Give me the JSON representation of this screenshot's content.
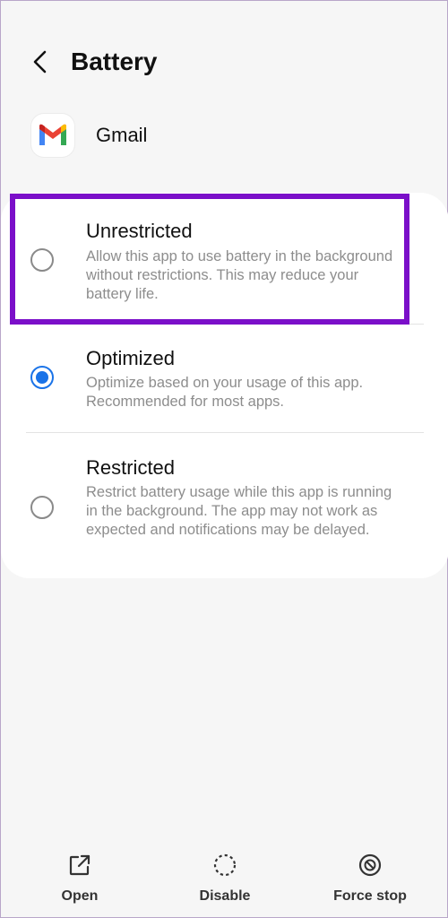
{
  "header": {
    "title": "Battery"
  },
  "app": {
    "name": "Gmail",
    "icon": "gmail-icon"
  },
  "options": [
    {
      "title": "Unrestricted",
      "description": "Allow this app to use battery in the background without restrictions. This may reduce your battery life.",
      "selected": false
    },
    {
      "title": "Optimized",
      "description": "Optimize based on your usage of this app. Recommended for most apps.",
      "selected": true
    },
    {
      "title": "Restricted",
      "description": "Restrict battery usage while this app is running in the background. The app may not work as expected and notifications may be delayed.",
      "selected": false
    }
  ],
  "bottom_actions": {
    "open": "Open",
    "disable": "Disable",
    "force_stop": "Force stop"
  },
  "colors": {
    "accent": "#1a73e8",
    "highlight": "#7b0fc9"
  }
}
